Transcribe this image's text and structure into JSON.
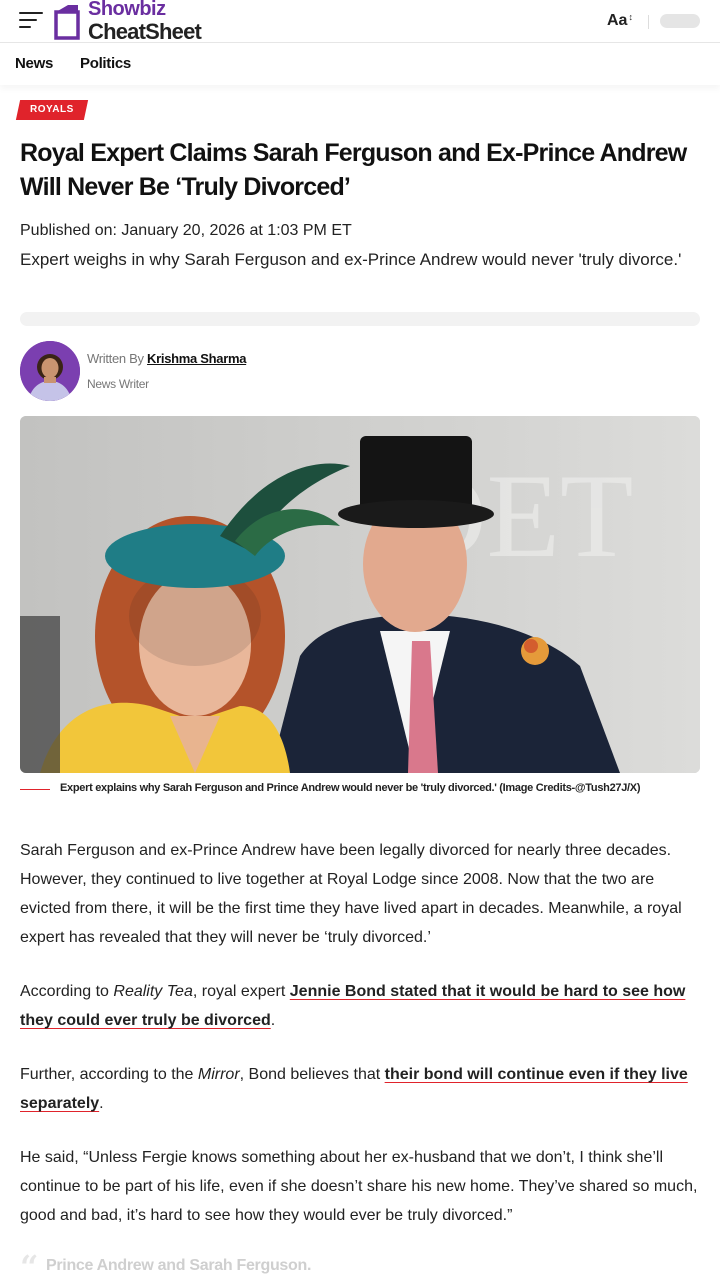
{
  "header": {
    "logo_line1": "Showbiz",
    "logo_line2": "CheatSheet",
    "font_toggle_label": "Aa",
    "font_toggle_arrows": "↕"
  },
  "nav": {
    "items": [
      "News",
      "Politics"
    ]
  },
  "article": {
    "category": "ROYALS",
    "title": "Royal Expert Claims Sarah Ferguson and Ex-Prince Andrew Will Never Be ‘Truly Divorced’",
    "published": "Published on: January 20, 2026 at 1:03 PM ET",
    "subtitle": "Expert weighs in why Sarah Ferguson and ex-Prince Andrew would never 'truly divorce.'",
    "author_prefix": "Written By",
    "author_name": "Krishma Sharma",
    "author_role": "News Writer",
    "image_caption": "Expert explains why Sarah Ferguson and Prince Andrew would never be 'truly divorced.' (Image Credits-@Tush27J/X)",
    "p1": "Sarah Ferguson and ex-Prince Andrew have been legally divorced for nearly three decades. However, they continued to live together at Royal Lodge since 2008. Now that the two are evicted from there, it will be the first time they have lived apart in decades. Meanwhile, a royal expert has revealed that they will never be ‘truly divorced.’",
    "p2_a": "According to ",
    "p2_source": "Reality Tea",
    "p2_b": ", royal expert ",
    "p2_link": "Jennie Bond stated that it would be hard to see how they could ever truly be divorced",
    "p2_c": ".",
    "p3_a": "Further, according to the ",
    "p3_source": "Mirror",
    "p3_b": ", Bond believes that ",
    "p3_link": "their bond will continue even if they live separately",
    "p3_c": ".",
    "p4": "He said, “Unless Fergie knows something about her ex-husband that we don’t, I think she’ll continue to be part of his life, even if she doesn’t share his new home. They’ve shared so much, good and bad, it’s hard to see how they would ever be truly divorced.”",
    "pullquote_mark": "“",
    "pullquote": "Prince Andrew and Sarah Ferguson."
  },
  "colors": {
    "accent_red": "#e0232b",
    "brand_purple": "#6a2ea0"
  },
  "icons": {
    "menu": "hamburger-icon",
    "logo": "showbiz-logo-mark"
  }
}
